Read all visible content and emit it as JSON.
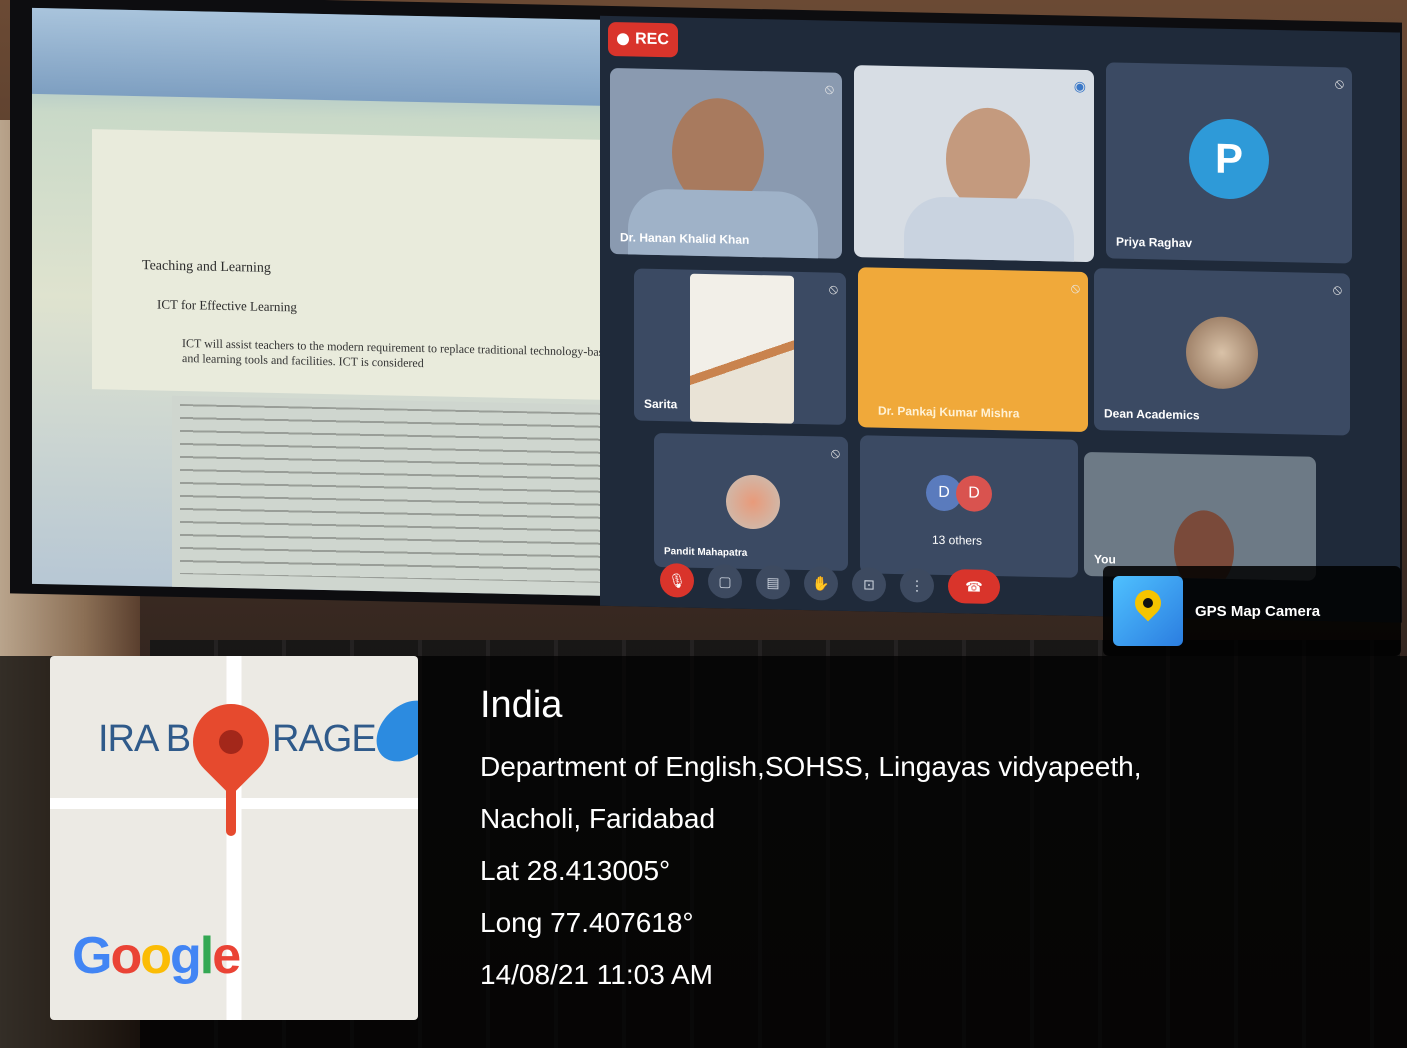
{
  "recording": {
    "label": "REC"
  },
  "meeting": {
    "participants": [
      {
        "name": "Dr. Hanan Khalid Khan"
      },
      {
        "name": ""
      },
      {
        "name": "Priya Raghav",
        "initial": "P"
      },
      {
        "name": "Sarita"
      },
      {
        "name": "Dr. Pankaj Kumar Mishra"
      },
      {
        "name": "Dean Academics"
      },
      {
        "name": "Pandit Mahapatra"
      },
      {
        "name": "13 others",
        "initials": [
          "D",
          "D"
        ]
      },
      {
        "name": "You"
      }
    ]
  },
  "document": {
    "heading1": "Teaching and Learning",
    "heading2": "ICT for Effective Learning",
    "body": "ICT will assist teachers to the modern requirement to replace traditional technology-based teaching and learning tools and facilities. ICT is considered"
  },
  "gps_badge": {
    "title": "GPS Map Camera"
  },
  "map": {
    "label_left": "IRA B",
    "label_right": "RAGE",
    "brand": "Google"
  },
  "location": {
    "country": "India",
    "address_line1": "Department of English,SOHSS, Lingayas vidyapeeth,",
    "address_line2": "Nacholi, Faridabad",
    "latitude": "Lat 28.413005°",
    "longitude": "Long 77.407618°",
    "datetime": "14/08/21 11:03 AM"
  },
  "colors": {
    "rec": "#d9342b",
    "tile_highlight": "#f0a93a",
    "avatar_p": "#2e9ad8",
    "map_pin": "#e64a2e"
  }
}
